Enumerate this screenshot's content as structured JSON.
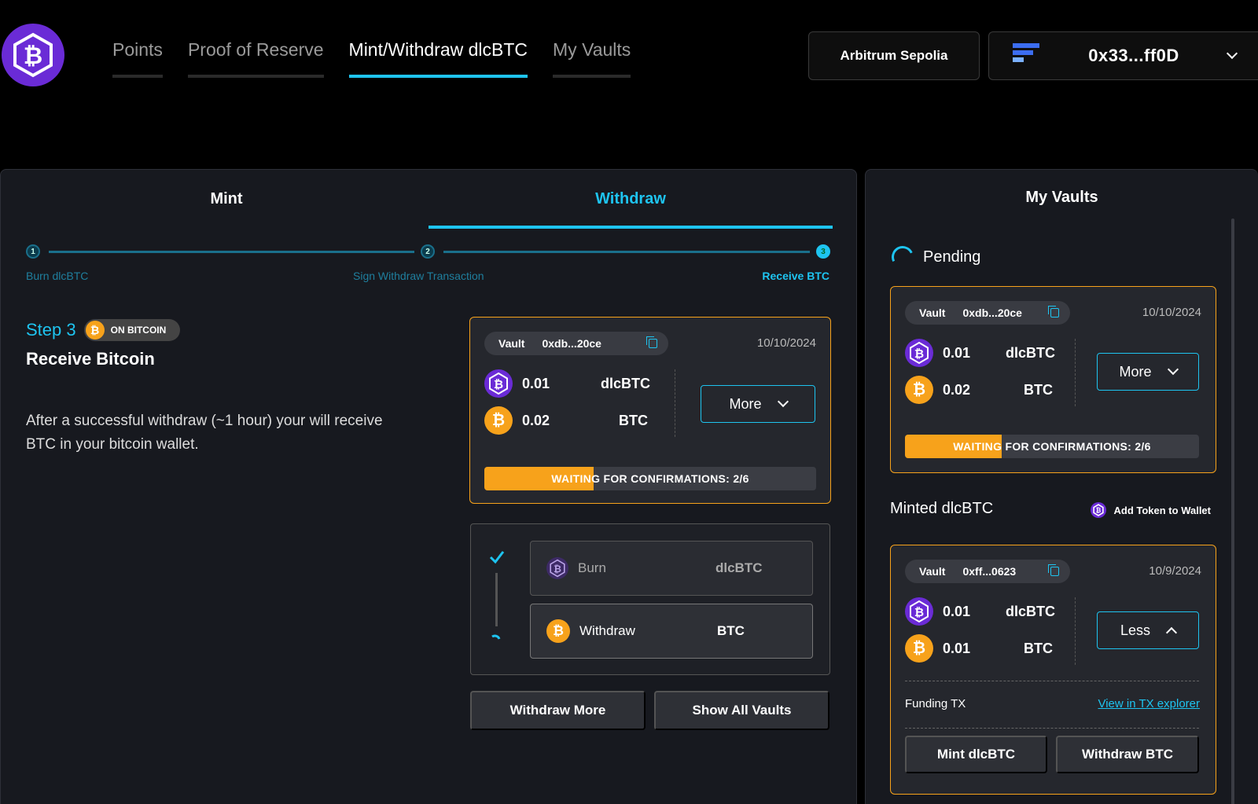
{
  "header": {
    "nav": [
      "Points",
      "Proof of Reserve",
      "Mint/Withdraw dlcBTC",
      "My Vaults"
    ],
    "network": "Arbitrum Sepolia",
    "wallet_address": "0x33...ff0D"
  },
  "left": {
    "tabs": [
      "Mint",
      "Withdraw"
    ],
    "steps": [
      "Burn dlcBTC",
      "Sign Withdraw Transaction",
      "Receive BTC"
    ],
    "step_numbers": [
      "1",
      "2",
      "3"
    ],
    "step_title": "Step 3",
    "badge": "ON BITCOIN",
    "heading": "Receive Bitcoin",
    "description": "After a successful withdraw (~1 hour) your will receive BTC in your bitcoin wallet.",
    "vault": {
      "label": "Vault",
      "id": "0xdb...20ce",
      "date": "10/10/2024",
      "dlc_amount": "0.01",
      "dlc_symbol": "dlcBTC",
      "btc_amount": "0.02",
      "btc_symbol": "BTC",
      "more": "More",
      "progress_text": "WAITING FOR CONFIRMATIONS: 2/6",
      "progress": 0.33
    },
    "flow": {
      "burn_label": "Burn",
      "burn_symbol": "dlcBTC",
      "withdraw_label": "Withdraw",
      "withdraw_symbol": "BTC"
    },
    "buttons": {
      "withdraw_more": "Withdraw More",
      "show_all": "Show All Vaults"
    }
  },
  "right": {
    "title": "My Vaults",
    "pending_label": "Pending",
    "pending_vault": {
      "label": "Vault",
      "id": "0xdb...20ce",
      "date": "10/10/2024",
      "dlc_amount": "0.01",
      "dlc_symbol": "dlcBTC",
      "btc_amount": "0.02",
      "btc_symbol": "BTC",
      "more": "More",
      "progress_text": "WAITING FOR CONFIRMATIONS: 2/6",
      "progress": 0.33
    },
    "minted_label": "Minted dlcBTC",
    "add_token": "Add Token to Wallet",
    "minted_vault": {
      "label": "Vault",
      "id": "0xff...0623",
      "date": "10/9/2024",
      "dlc_amount": "0.01",
      "dlc_symbol": "dlcBTC",
      "btc_amount": "0.01",
      "btc_symbol": "BTC",
      "less": "Less",
      "funding_label": "Funding TX",
      "explorer_link": "View in TX explorer",
      "mint_btn": "Mint dlcBTC",
      "withdraw_btn": "Withdraw BTC"
    }
  },
  "colors": {
    "accent": "#1ec4f0",
    "btc": "#f7a21b",
    "dlc": "#6a2bd6"
  },
  "icons": {
    "logo": "dlcbtc-logo-icon",
    "wallet": "wallet-provider-icon",
    "btc": "btc-coin-icon",
    "dlc": "dlcbtc-coin-icon"
  }
}
